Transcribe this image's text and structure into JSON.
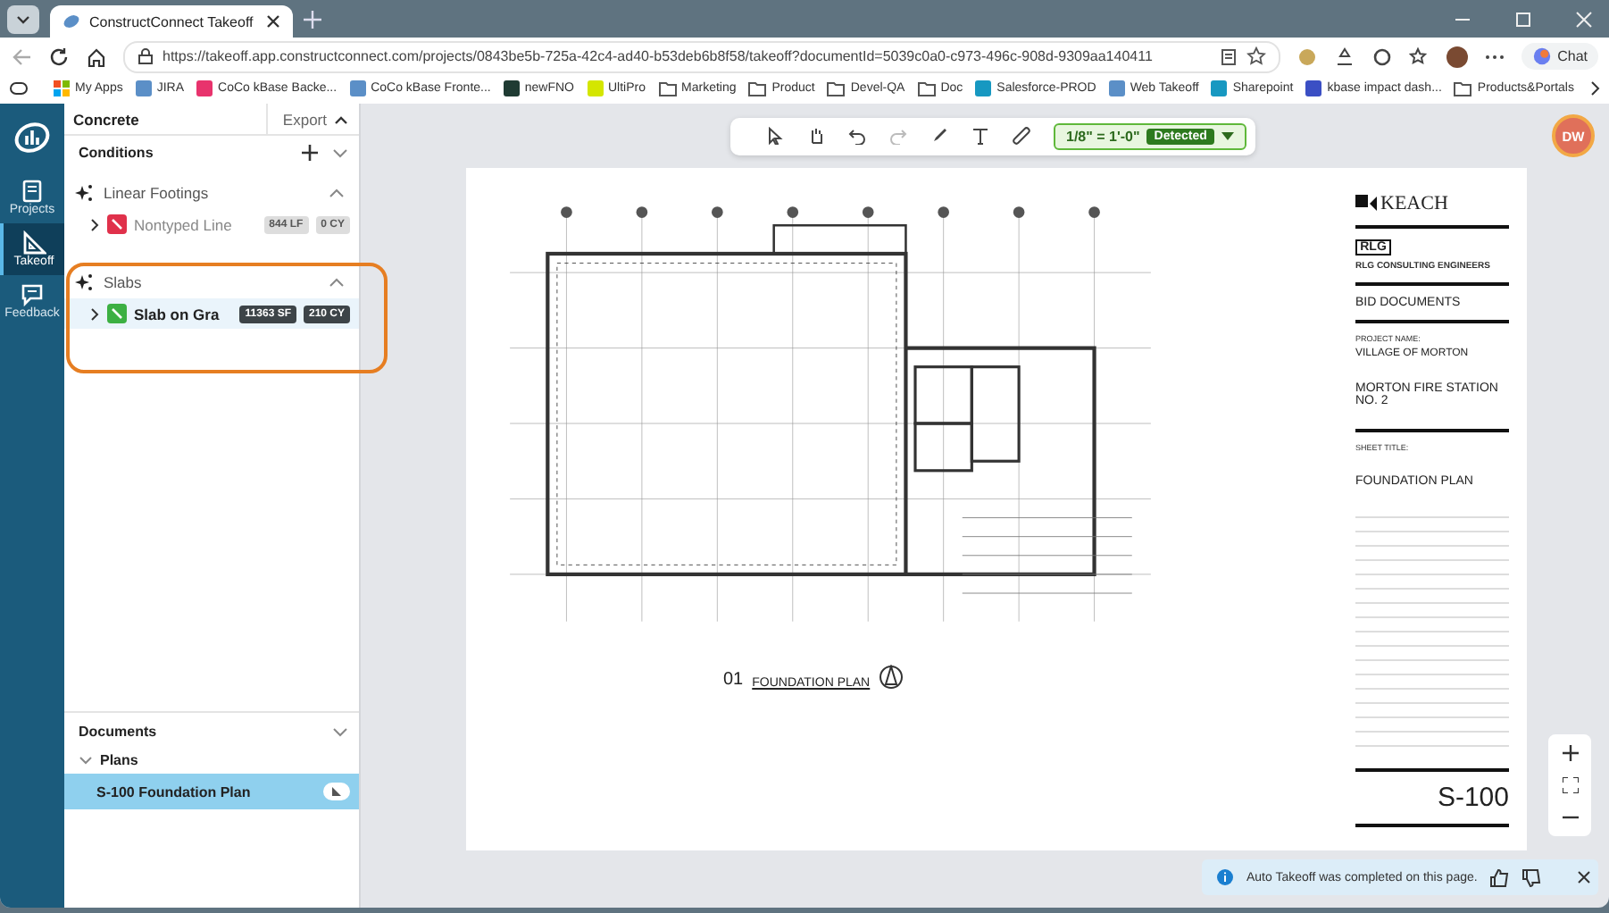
{
  "browser": {
    "tabs": [
      {
        "title": "ConstructConnect Takeoff",
        "selected": true
      }
    ],
    "url": "https://takeoff.app.constructconnect.com/projects/0843be5b-725a-42c4-ad40-b53deb6b8f58/takeoff?documentId=5039c0a0-c973-496c-908d-9309aa140411",
    "chat": "Chat",
    "bookmarks": [
      {
        "label": "My Apps",
        "kind": "apps",
        "color": "#f25022"
      },
      {
        "label": "JIRA",
        "kind": "site",
        "color": "#5b8fc7"
      },
      {
        "label": "CoCo kBase Backe...",
        "kind": "site",
        "color": "#e8336d"
      },
      {
        "label": "CoCo kBase Fronte...",
        "kind": "site",
        "color": "#5b8fc7"
      },
      {
        "label": "newFNO",
        "kind": "site",
        "color": "#1f3b33"
      },
      {
        "label": "UltiPro",
        "kind": "site",
        "color": "#d4e600"
      },
      {
        "label": "Marketing",
        "kind": "folder",
        "color": "#555555"
      },
      {
        "label": "Product",
        "kind": "folder",
        "color": "#555555"
      },
      {
        "label": "Devel-QA",
        "kind": "folder",
        "color": "#555555"
      },
      {
        "label": "Doc",
        "kind": "folder",
        "color": "#555555"
      },
      {
        "label": "Salesforce-PROD",
        "kind": "site",
        "color": "#1798c1"
      },
      {
        "label": "Web Takeoff",
        "kind": "site",
        "color": "#5b8fc7"
      },
      {
        "label": "Sharepoint",
        "kind": "site",
        "color": "#1798c1"
      },
      {
        "label": "kbase impact dash...",
        "kind": "site",
        "color": "#3b4fc4"
      },
      {
        "label": "Products&Portals",
        "kind": "folder",
        "color": "#555555"
      }
    ]
  },
  "nav": [
    {
      "label": "Projects",
      "selected": false
    },
    {
      "label": "Takeoff",
      "selected": true
    },
    {
      "label": "Feedback",
      "selected": false
    }
  ],
  "panel": {
    "title": "Concrete",
    "export": "Export",
    "conditions": "Conditions",
    "groups": [
      {
        "name": "Linear Footings",
        "expanded": true,
        "items": [
          {
            "name": "Nontyped Line",
            "color": "#e0314b",
            "selected": false,
            "quantities": [
              "844 LF",
              "0 CY"
            ]
          }
        ]
      },
      {
        "name": "Slabs",
        "expanded": true,
        "items": [
          {
            "name": "Slab on Gra",
            "color": "#3cb043",
            "selected": true,
            "quantities": [
              "11363 SF",
              "210 CY"
            ]
          }
        ]
      }
    ],
    "documents": "Documents",
    "folders": [
      {
        "name": "Plans",
        "expanded": true,
        "items": [
          {
            "name": "S-100 Foundation Plan",
            "selected": true
          }
        ]
      }
    ]
  },
  "toolbar": {
    "scale": "1/8\" = 1'-0\"",
    "badge": "Detected"
  },
  "avatar": "DW",
  "sheet": {
    "caption_number": "01",
    "caption": "FOUNDATION PLAN",
    "firm": "KEACH",
    "engineer_logo": "RLG",
    "engineer": "RLG CONSULTING ENGINEERS",
    "status": "BID DOCUMENTS",
    "project_label": "PROJECT NAME:",
    "project": "VILLAGE OF MORTON",
    "building": "MORTON FIRE STATION NO. 2",
    "sheet_title_label": "SHEET TITLE:",
    "sheet_title": "FOUNDATION PLAN",
    "sheet_number": "S-100"
  },
  "toast": {
    "message": "Auto Takeoff was completed on this page."
  }
}
